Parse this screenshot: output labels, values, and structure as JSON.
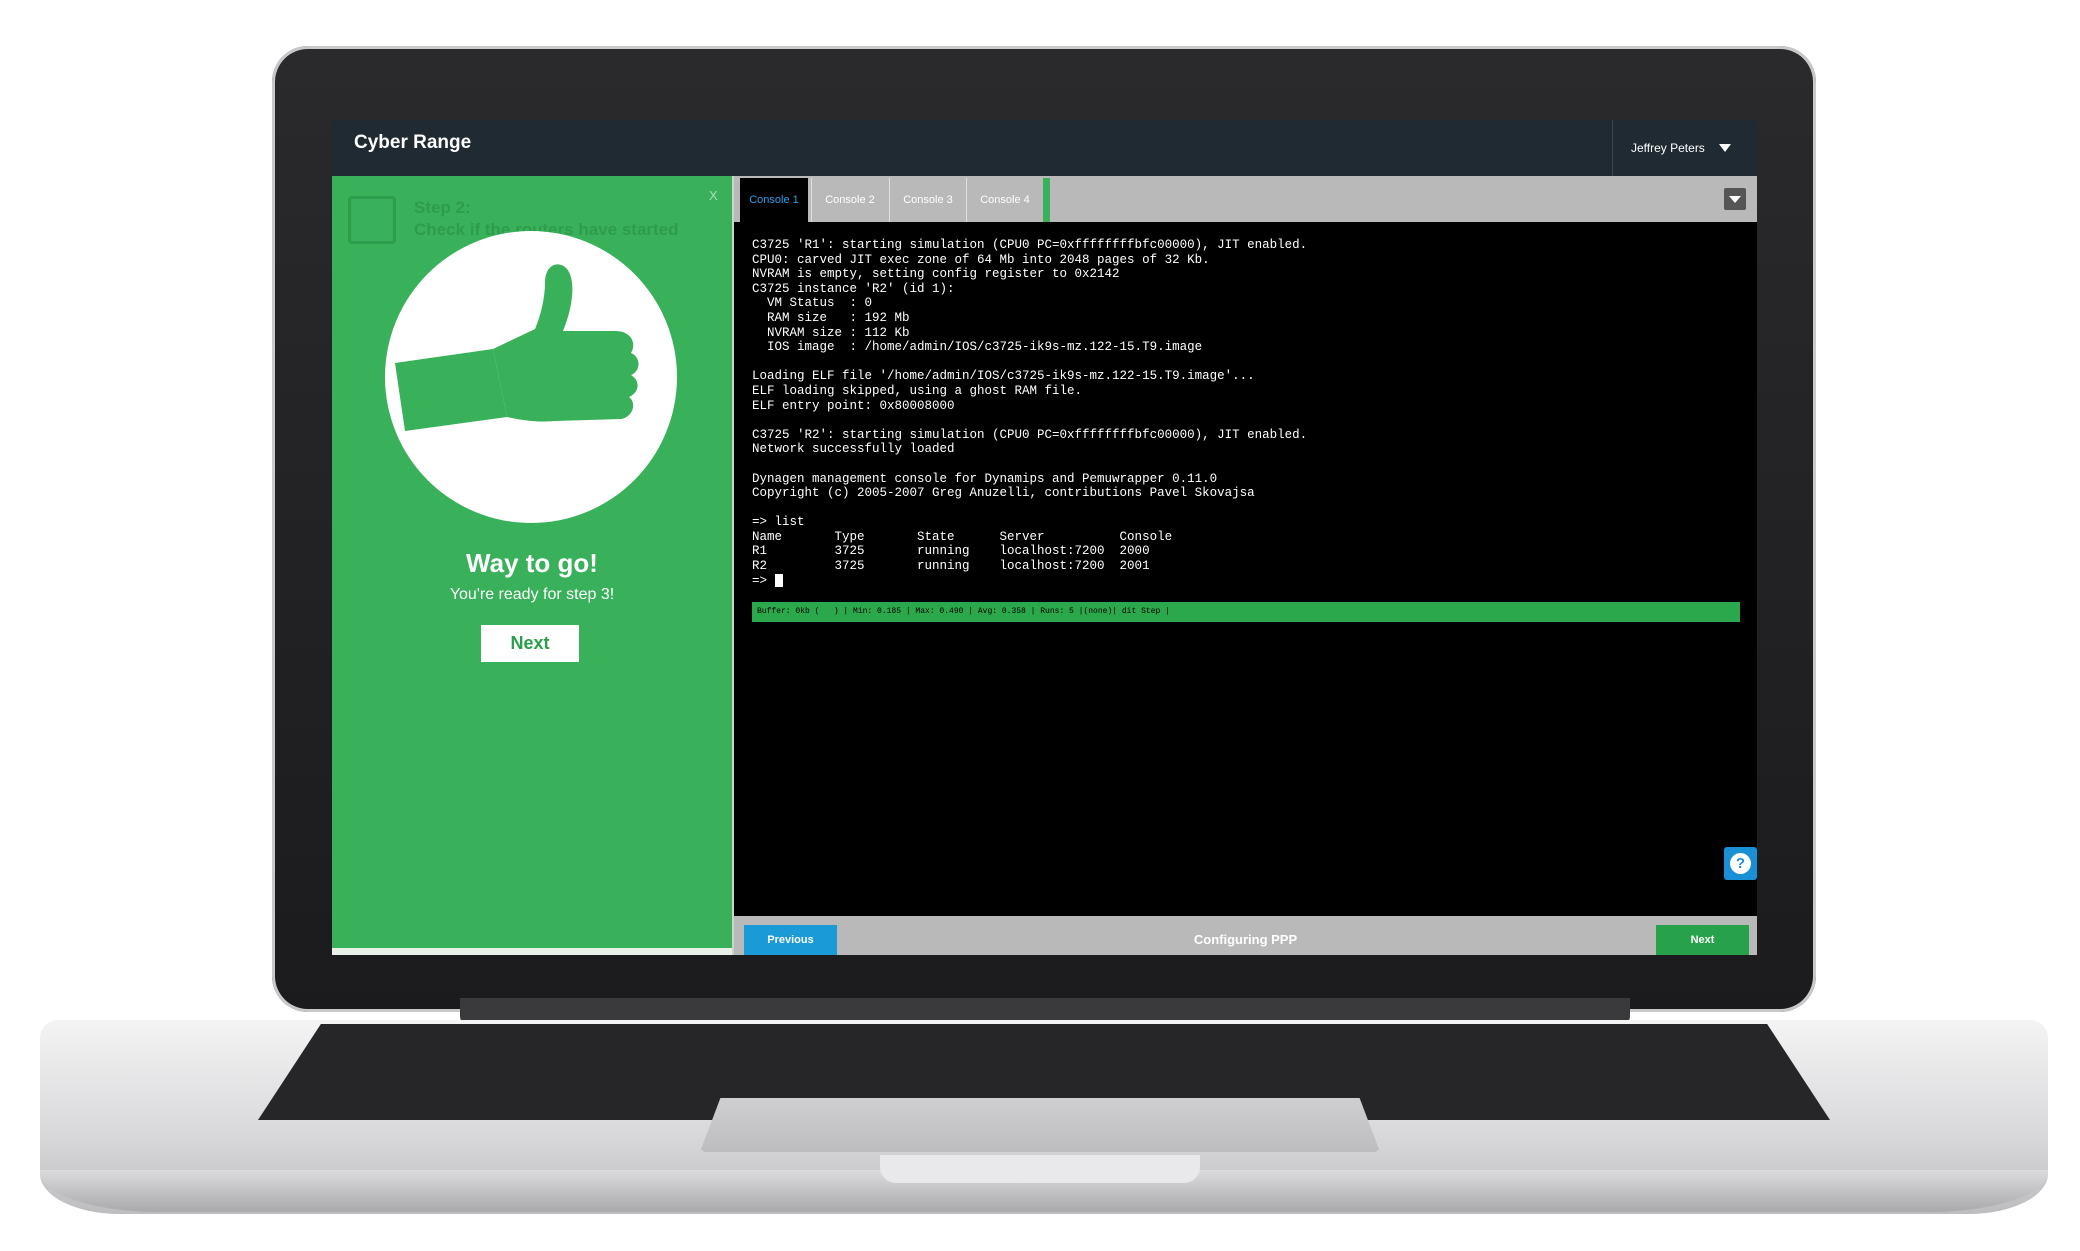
{
  "app": {
    "title": "Cyber Range",
    "user": "Jeffrey Peters"
  },
  "left_panel": {
    "step_label": "Step 2:",
    "step_title": "Check if the routers have started",
    "close": "X",
    "success_title": "Way to go!",
    "success_subtitle": "You're ready for step 3!",
    "next_label": "Next"
  },
  "tabs": [
    {
      "label": "Console 1",
      "active": true
    },
    {
      "label": "Console 2",
      "active": false
    },
    {
      "label": "Console 3",
      "active": false
    },
    {
      "label": "Console 4",
      "active": false
    }
  ],
  "terminal": {
    "lines": [
      "C3725 'R1': starting simulation (CPU0 PC=0xffffffffbfc00000), JIT enabled.",
      "CPU0: carved JIT exec zone of 64 Mb into 2048 pages of 32 Kb.",
      "NVRAM is empty, setting config register to 0x2142",
      "C3725 instance 'R2' (id 1):",
      "  VM Status  : 0",
      "  RAM size   : 192 Mb",
      "  NVRAM size : 112 Kb",
      "  IOS image  : /home/admin/IOS/c3725-ik9s-mz.122-15.T9.image",
      "",
      "Loading ELF file '/home/admin/IOS/c3725-ik9s-mz.122-15.T9.image'...",
      "ELF loading skipped, using a ghost RAM file.",
      "ELF entry point: 0x80008000",
      "",
      "C3725 'R2': starting simulation (CPU0 PC=0xffffffffbfc00000), JIT enabled.",
      "Network successfully loaded",
      "",
      "Dynagen management console for Dynamips and Pemuwrapper 0.11.0",
      "Copyright (c) 2005-2007 Greg Anuzelli, contributions Pavel Skovajsa",
      "",
      "=> list",
      "Name       Type       State      Server          Console",
      "R1         3725       running    localhost:7200  2000",
      "R2         3725       running    localhost:7200  2001"
    ],
    "prompt": "=> ",
    "status_line": "Buffer: 0kb (   ) | Min: 0.185 | Max: 0.490 | Avg: 0.358 | Runs: 5 |(none)| dit Step |"
  },
  "bottom": {
    "previous_label": "Previous",
    "step_name": "Configuring PPP",
    "next_label": "Next"
  },
  "help_icon": "question-icon",
  "colors": {
    "green": "#38b15a",
    "blue": "#1a9ad6",
    "topbar": "#1f2a33",
    "tab_active_text": "#2aa0e8"
  }
}
